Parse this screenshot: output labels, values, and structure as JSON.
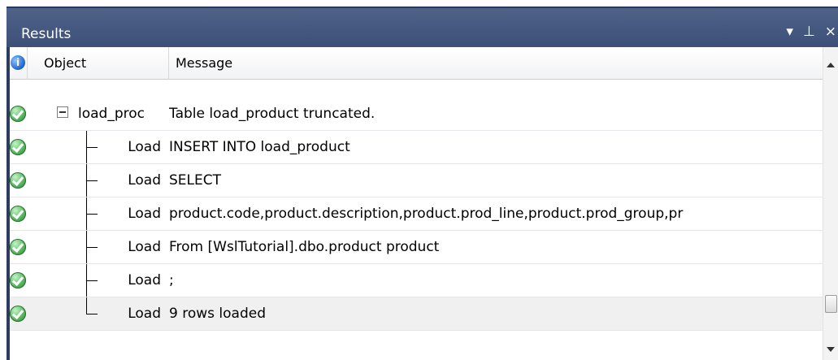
{
  "panel": {
    "title": "Results",
    "controls": {
      "dropdown": "▾",
      "pin": "⊥",
      "close": "×"
    }
  },
  "columns": {
    "object": "Object",
    "message": "Message"
  },
  "rows": [
    {
      "object": "load_proc",
      "message": "Table load_product truncated.",
      "status": "success",
      "level": "root"
    },
    {
      "object": "Load",
      "message": "INSERT INTO load_product",
      "status": "success",
      "level": "child"
    },
    {
      "object": "Load",
      "message": "SELECT",
      "status": "success",
      "level": "child"
    },
    {
      "object": "Load",
      "message": "product.code,product.description,product.prod_line,product.prod_group,pr",
      "status": "success",
      "level": "child"
    },
    {
      "object": "Load",
      "message": "From [WslTutorial].dbo.product product",
      "status": "success",
      "level": "child"
    },
    {
      "object": "Load",
      "message": ";",
      "status": "success",
      "level": "child"
    },
    {
      "object": "Load",
      "message": "9 rows loaded",
      "status": "success",
      "level": "child"
    }
  ],
  "colors": {
    "titlebar": "#44577f",
    "success": "#57b95e",
    "selected_row": "#f0f0f0"
  }
}
